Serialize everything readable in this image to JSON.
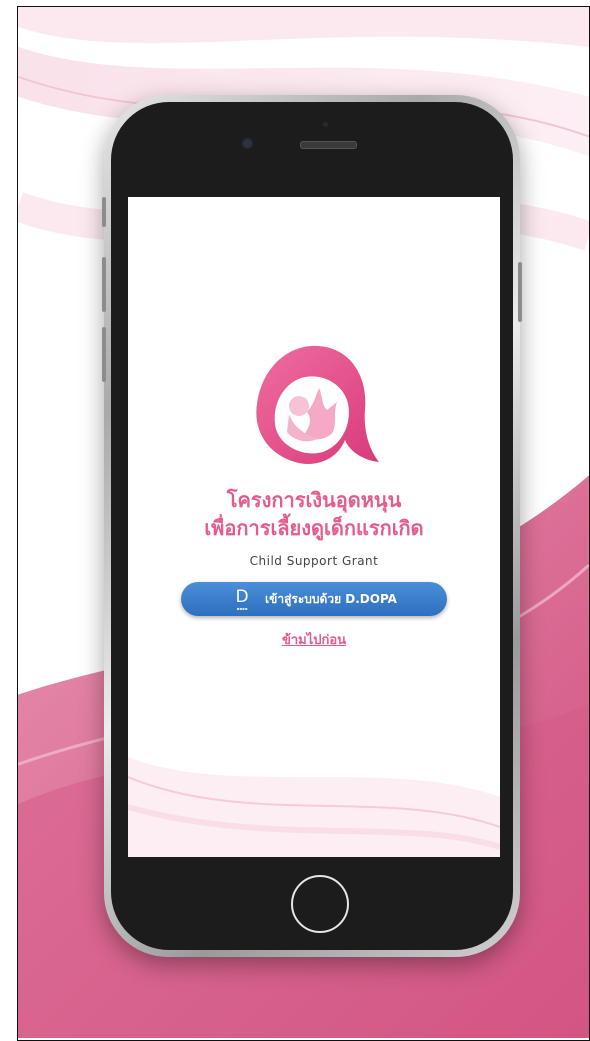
{
  "app": {
    "title_line1": "โครงการเงินอุดหนุน",
    "title_line2": "เพื่อการเลี้ยงดูเด็กแรกเกิด",
    "subtitle": "Child Support Grant"
  },
  "login": {
    "logo_letter": "D",
    "label": "เข้าสู่ระบบด้วย D.DOPA"
  },
  "skip_label": "ข้ามไปก่อน",
  "colors": {
    "brand_pink": "#e45c8e",
    "button_blue": "#3a7ccb",
    "phone_body": "#1c1c1c"
  },
  "icons": [
    "mother-child-logo-icon",
    "d-dopa-logo-icon",
    "camera-icon",
    "home-button-icon"
  ]
}
